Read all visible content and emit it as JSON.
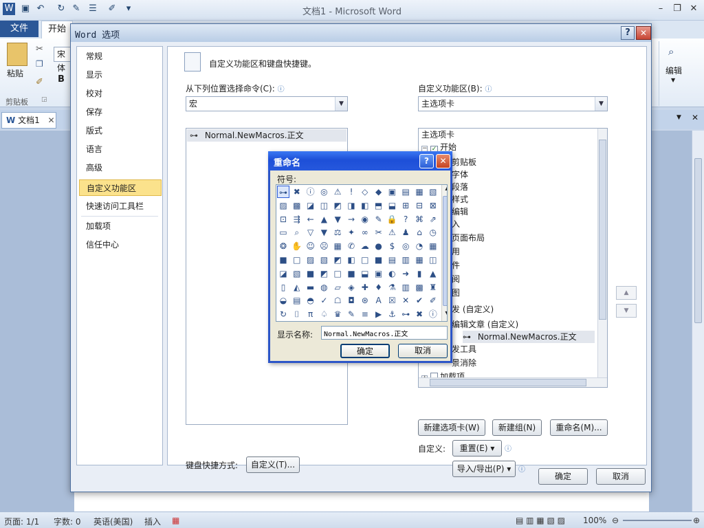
{
  "window": {
    "title": "文档1 - Microsoft Word",
    "tab_file": "文件",
    "tab_home": "开始",
    "doc_tab": "文档1"
  },
  "ribbon": {
    "paste": "粘贴",
    "clipboard_group": "剪贴板",
    "font_name": "宋体",
    "bold": "B",
    "edit_group": "编辑"
  },
  "status": {
    "page": "页面: 1/1",
    "words": "字数: 0",
    "language": "英语(美国)",
    "insert": "插入",
    "zoom": "100%"
  },
  "options": {
    "title": "Word 选项",
    "nav": [
      "常规",
      "显示",
      "校对",
      "保存",
      "版式",
      "语言",
      "高级",
      "自定义功能区",
      "快速访问工具栏",
      "加载项",
      "信任中心"
    ],
    "selected_nav": "自定义功能区",
    "header": "自定义功能区和键盘快捷键。",
    "choose_label": "从下列位置选择命令(C):",
    "choose_value": "宏",
    "customize_label": "自定义功能区(B):",
    "customize_value": "主选项卡",
    "left_list": [
      "Normal.NewMacros.正文"
    ],
    "tree": [
      "主选项卡",
      "开始",
      "剪贴板",
      "字体",
      "段落",
      "样式",
      "编辑",
      "入",
      "页面布局",
      "用",
      "件",
      "阅",
      "图",
      "发 (自定义)",
      "编辑文章 (自定义)",
      "Normal.NewMacros.正文",
      "发工具",
      "景消除",
      "加载项"
    ],
    "new_tab": "新建选项卡(W)",
    "new_group": "新建组(N)",
    "rename": "重命名(M)...",
    "customize_text": "自定义:",
    "reset": "重置(E) ▾",
    "import_export": "导入/导出(P) ▾",
    "keyboard_label": "键盘快捷方式:",
    "keyboard_btn": "自定义(T)...",
    "ok": "确定",
    "cancel": "取消"
  },
  "rename_dialog": {
    "title": "重命名",
    "symbols_label": "符号:",
    "display_name_label": "显示名称:",
    "display_name_value": "Normal.NewMacros.正文",
    "ok": "确定",
    "cancel": "取消"
  }
}
